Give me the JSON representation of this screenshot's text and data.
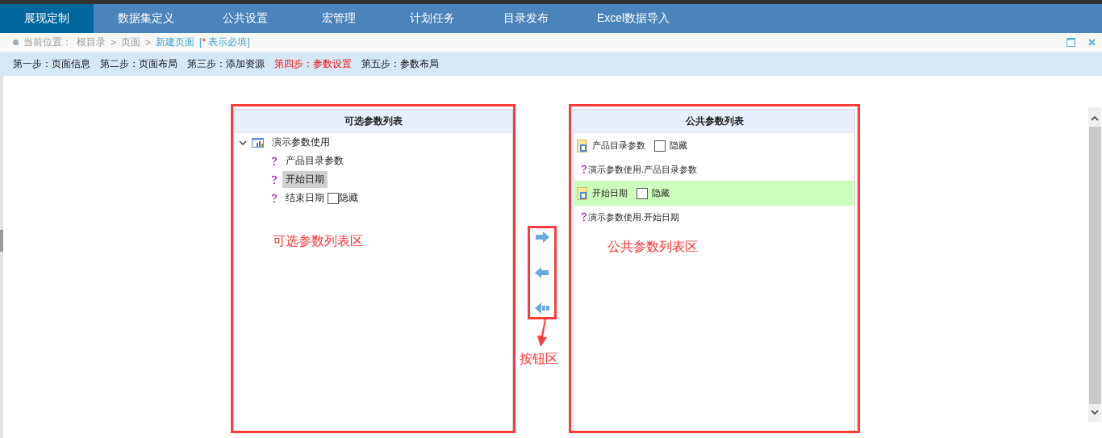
{
  "nav": {
    "tabs": [
      {
        "label": "展现定制",
        "selected": true
      },
      {
        "label": "数据集定义",
        "selected": false
      },
      {
        "label": "公共设置",
        "selected": false
      },
      {
        "label": "宏管理",
        "selected": false
      },
      {
        "label": "计划任务",
        "selected": false
      },
      {
        "label": "目录发布",
        "selected": false
      },
      {
        "label": "Excel数据导入",
        "selected": false
      }
    ]
  },
  "breadcrumb": {
    "label": "当前位置：",
    "crumbs": [
      "根目录",
      ">",
      "页面",
      ">"
    ],
    "current": "新建页面",
    "note": {
      "open": "[",
      "star": "*",
      "text": "表示必填]"
    }
  },
  "steps": [
    {
      "label": "第一步：页面信息",
      "selected": false
    },
    {
      "label": "第二步：页面布局",
      "selected": false
    },
    {
      "label": "第三步：添加资源",
      "selected": false
    },
    {
      "label": "第四步：参数设置",
      "selected": true
    },
    {
      "label": "第五步：参数布局",
      "selected": false
    }
  ],
  "left_panel": {
    "title": "可选参数列表",
    "annotation": "可选参数列表区",
    "tree": [
      {
        "label": "演示参数使用",
        "expanded": true,
        "children": [
          {
            "label": "产品目录参数",
            "selected": false
          },
          {
            "label": "开始日期",
            "selected": true
          },
          {
            "label": "结束日期",
            "selected": false,
            "hide_label": "隐藏",
            "hidden": false
          }
        ]
      }
    ]
  },
  "transfer": {
    "annotation": "按钮区",
    "buttons": [
      {
        "kind": "add"
      },
      {
        "kind": "remove"
      },
      {
        "kind": "remove_all"
      }
    ]
  },
  "right_panel": {
    "title": "公共参数列表",
    "annotation": "公共参数列表区",
    "items": [
      {
        "name": "产品目录参数",
        "hide_label": "隐藏",
        "hidden": false,
        "source": "演示参数使用.产品目录参数",
        "selected": false
      },
      {
        "name": "开始日期",
        "hide_label": "隐藏",
        "hidden": false,
        "source": "演示参数使用.开始日期",
        "selected": true
      }
    ]
  }
}
